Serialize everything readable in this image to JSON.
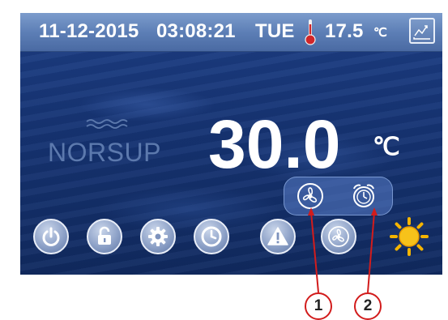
{
  "status_bar": {
    "date": "11-12-2015",
    "time": "03:08:21",
    "day": "TUE",
    "outdoor_temp": "17.5",
    "outdoor_temp_unit": "℃"
  },
  "brand": {
    "logo_text": "NORSUP"
  },
  "main": {
    "set_temperature": "30.0",
    "unit": "℃"
  },
  "icons": {
    "thermometer": "thermometer-icon",
    "chart": "trend-chart-icon",
    "fan_mode": "fan-icon",
    "timer_mode": "alarm-clock-icon",
    "power": "power-icon",
    "lock": "unlock-icon",
    "settings": "gear-icon",
    "timer": "clock-icon",
    "alarm": "warning-icon",
    "fan": "fan-icon",
    "heat_mode": "sun-icon"
  },
  "callouts": {
    "one": "1",
    "two": "2"
  },
  "colors": {
    "screen_bg": "#163474",
    "topbar": "#5d7fb6",
    "thermometer": "#d0262a",
    "sun": "#f5b400",
    "callout": "#d21c1c"
  }
}
